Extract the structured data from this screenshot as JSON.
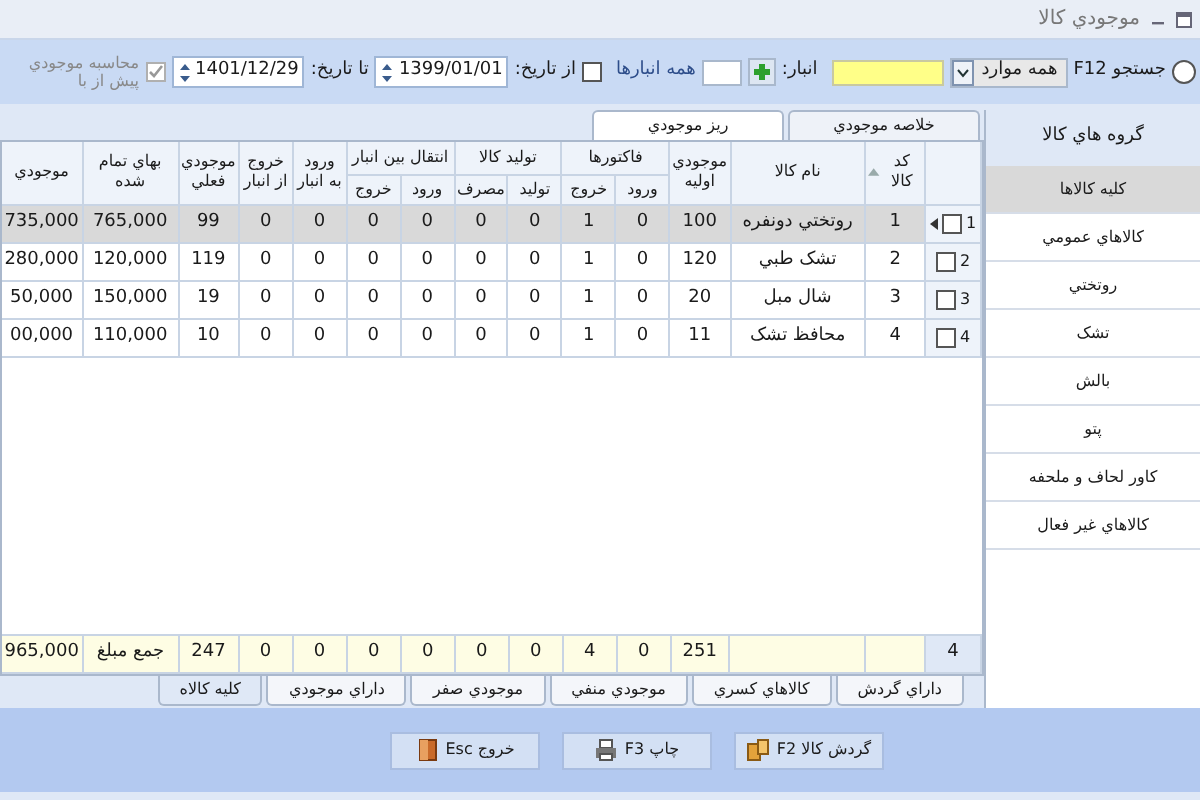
{
  "window": {
    "title": "موجودي کالا"
  },
  "toolbar": {
    "search_selected": false,
    "search_label": "جستجو F12",
    "search_mode": "همه موارد",
    "warehouse_label": "انبار:",
    "all_warehouses": "همه انبارها",
    "from_checked": false,
    "from_label": "از تاريخ:",
    "from_date": "1399/01/01",
    "to_label": "تا تاريخ:",
    "to_date": "1401/12/29",
    "calc_checked": true,
    "calc_label": "محاسبه موجودي پيش از با"
  },
  "tabs": [
    {
      "label": "خلاصه موجودي",
      "selected": false
    },
    {
      "label": "ريز موجودي",
      "selected": true
    }
  ],
  "table": {
    "columns": [
      {
        "label": "کد کالا",
        "sorted": true
      },
      {
        "label": "نام کالا"
      },
      {
        "label": "موجودي اوليه"
      },
      {
        "label": "فاکتورها",
        "colspan": 2,
        "children": [
          {
            "label": "ورود"
          },
          {
            "label": "خروج"
          }
        ]
      },
      {
        "label": "توليد کالا",
        "colspan": 2,
        "children": [
          {
            "label": "توليد"
          },
          {
            "label": "مصرف"
          }
        ]
      },
      {
        "label": "انتقال بين انبار",
        "colspan": 2,
        "children": [
          {
            "label": "ورود"
          },
          {
            "label": "خروج"
          }
        ]
      },
      {
        "label": "ورود به انبار"
      },
      {
        "label": "خروج از انبار"
      },
      {
        "label": "موجودي فعلي"
      },
      {
        "label": "بهاي تمام شده"
      },
      {
        "label": "موجودي"
      }
    ],
    "rows": [
      {
        "number": "1",
        "selected": true,
        "checked": false,
        "cells": [
          "1",
          "روتختي دونفره",
          "100",
          "0",
          "1",
          "0",
          "0",
          "0",
          "0",
          "0",
          "0",
          "99",
          "765,000",
          "735,000"
        ]
      },
      {
        "number": "2",
        "selected": false,
        "checked": false,
        "cells": [
          "2",
          "تشک طبي",
          "120",
          "0",
          "1",
          "0",
          "0",
          "0",
          "0",
          "0",
          "0",
          "119",
          "120,000",
          "280,000"
        ]
      },
      {
        "number": "3",
        "selected": false,
        "checked": false,
        "cells": [
          "3",
          "شال مبل",
          "20",
          "0",
          "1",
          "0",
          "0",
          "0",
          "0",
          "0",
          "0",
          "19",
          "150,000",
          "50,000"
        ]
      },
      {
        "number": "4",
        "selected": false,
        "checked": false,
        "cells": [
          "4",
          "محافظ تشک",
          "11",
          "0",
          "1",
          "0",
          "0",
          "0",
          "0",
          "0",
          "0",
          "10",
          "110,000",
          "00,000"
        ]
      }
    ],
    "totals": {
      "count": "4",
      "cells": [
        null,
        null,
        "251",
        "0",
        "4",
        "0",
        "0",
        "0",
        "0",
        "0",
        "0",
        "247",
        "جمع مبلغ",
        "965,000"
      ]
    }
  },
  "bottom_tabs": [
    {
      "label": "داراي گردش",
      "selected": false
    },
    {
      "label": "کالاهاي کسري",
      "selected": false
    },
    {
      "label": "موجودي منفي",
      "selected": false
    },
    {
      "label": "موجودي صفر",
      "selected": false
    },
    {
      "label": "داراي موجودي",
      "selected": false
    },
    {
      "label": "کليه کالاه",
      "selected": true
    }
  ],
  "sidebar": {
    "title": "گروه هاي کالا",
    "items": [
      {
        "label": "کليه کالاها",
        "selected": true
      },
      {
        "label": "کالاهاي عمومي",
        "selected": false
      },
      {
        "label": "روتختي",
        "selected": false
      },
      {
        "label": "تشک",
        "selected": false
      },
      {
        "label": "بالش",
        "selected": false
      },
      {
        "label": "پتو",
        "selected": false
      },
      {
        "label": "کاور لحاف و ملحفه",
        "selected": false
      },
      {
        "label": "کالاهاي غير فعال",
        "selected": false
      }
    ]
  },
  "buttons": [
    {
      "label": "گردش کالا F2",
      "kind": "flow"
    },
    {
      "label": "چاپ F3",
      "kind": "print"
    },
    {
      "label": "خروج Esc",
      "kind": "exit"
    }
  ]
}
